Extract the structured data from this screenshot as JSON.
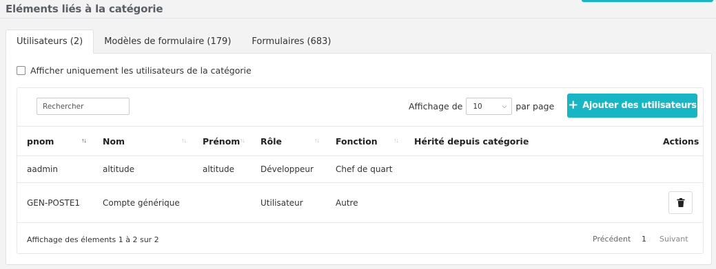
{
  "section": {
    "title": "Eléments liés à la catégorie"
  },
  "tabs": [
    {
      "label": "Utilisateurs (2)"
    },
    {
      "label": "Modèles de formulaire (179)"
    },
    {
      "label": "Formulaires (683)"
    }
  ],
  "filter": {
    "checkbox_label": "Afficher uniquement les utilisateurs de la catégorie",
    "checked": false
  },
  "toolbar": {
    "search_placeholder": "Rechercher",
    "length_prefix": "Affichage de",
    "length_value": "10",
    "length_suffix": "par page",
    "add_label": "Ajouter des utilisateurs"
  },
  "table": {
    "columns": [
      "pnom",
      "Nom",
      "Prénom",
      "Rôle",
      "Fonction",
      "Hérité depuis catégorie",
      "Actions"
    ],
    "sorted_column": "pnom",
    "rows": [
      {
        "pnom": "aadmin",
        "nom": "altitude",
        "prenom": "altitude",
        "role": "Développeur",
        "fonction": "Chef de quart",
        "herite": "",
        "has_delete": false
      },
      {
        "pnom": "GEN-POSTE1",
        "nom": "Compte générique",
        "prenom": "",
        "role": "Utilisateur",
        "fonction": "Autre",
        "herite": "",
        "has_delete": true
      }
    ]
  },
  "footer": {
    "info": "Affichage des élements 1 à 2 sur 2",
    "prev": "Précédent",
    "page": "1",
    "next": "Suivant"
  },
  "colors": {
    "accent": "#17b6c4"
  }
}
